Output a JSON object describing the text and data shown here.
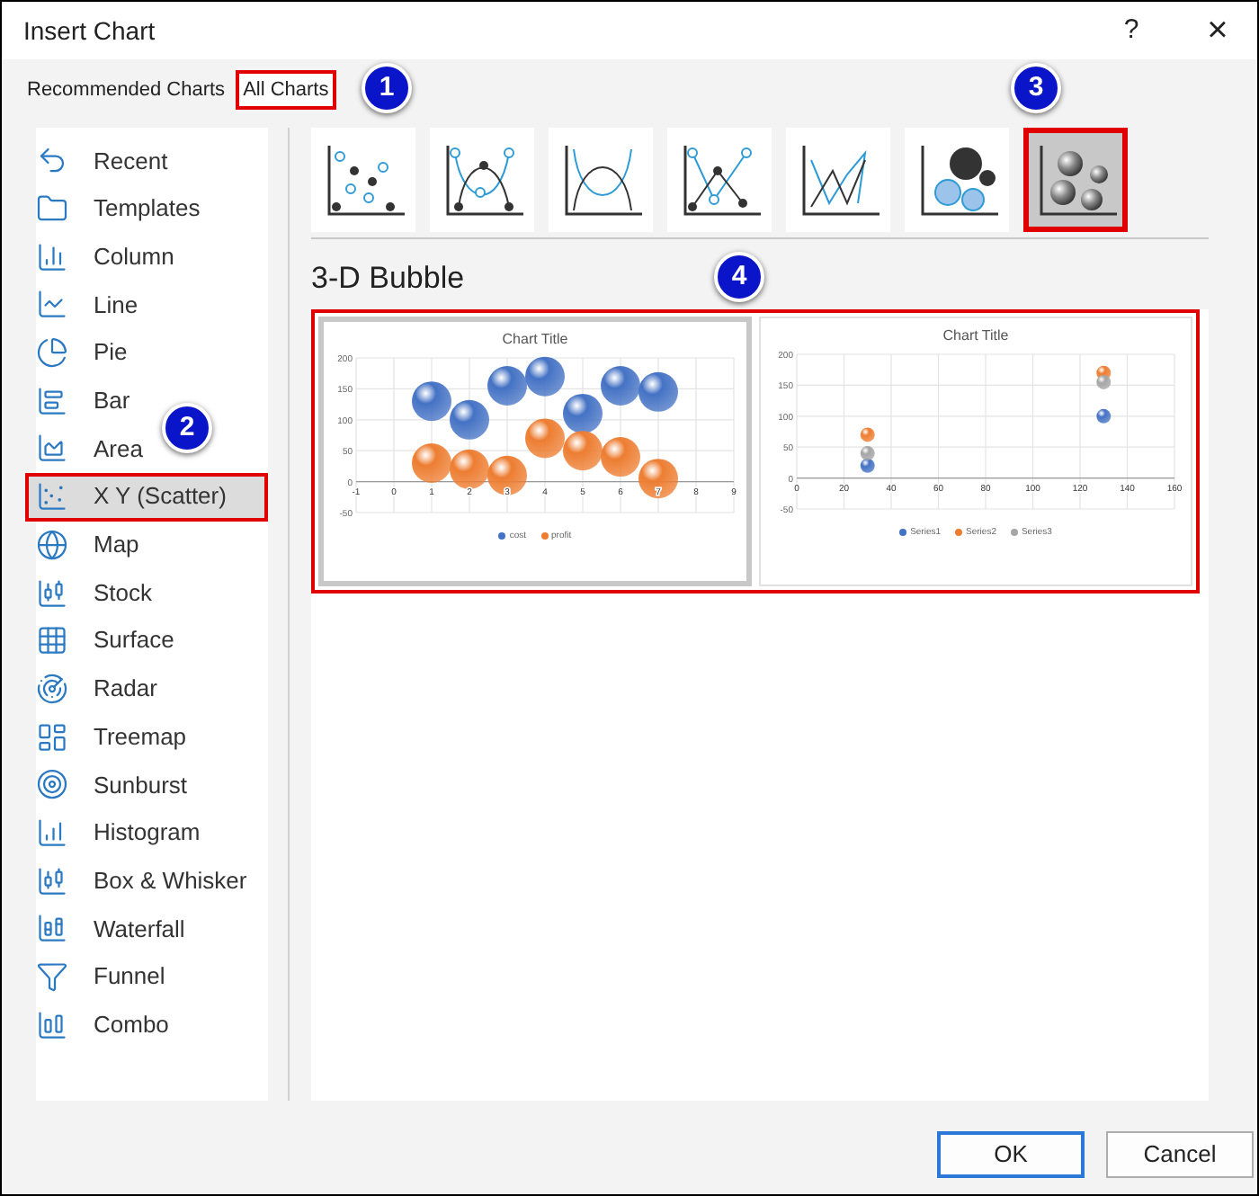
{
  "window": {
    "title": "Insert Chart",
    "help": "?",
    "close": "×"
  },
  "tabs": [
    {
      "label": "Recommended Charts",
      "selected": false,
      "highlighted": false
    },
    {
      "label": "All Charts",
      "selected": true,
      "highlighted": true
    }
  ],
  "sidebar": {
    "items": [
      {
        "label": "Recent",
        "selected": false,
        "highlighted": false
      },
      {
        "label": "Templates",
        "selected": false,
        "highlighted": false
      },
      {
        "label": "Column",
        "selected": false,
        "highlighted": false
      },
      {
        "label": "Line",
        "selected": false,
        "highlighted": false
      },
      {
        "label": "Pie",
        "selected": false,
        "highlighted": false
      },
      {
        "label": "Bar",
        "selected": false,
        "highlighted": false
      },
      {
        "label": "Area",
        "selected": false,
        "highlighted": false
      },
      {
        "label": "X Y (Scatter)",
        "selected": true,
        "highlighted": true
      },
      {
        "label": "Map",
        "selected": false,
        "highlighted": false
      },
      {
        "label": "Stock",
        "selected": false,
        "highlighted": false
      },
      {
        "label": "Surface",
        "selected": false,
        "highlighted": false
      },
      {
        "label": "Radar",
        "selected": false,
        "highlighted": false
      },
      {
        "label": "Treemap",
        "selected": false,
        "highlighted": false
      },
      {
        "label": "Sunburst",
        "selected": false,
        "highlighted": false
      },
      {
        "label": "Histogram",
        "selected": false,
        "highlighted": false
      },
      {
        "label": "Box & Whisker",
        "selected": false,
        "highlighted": false
      },
      {
        "label": "Waterfall",
        "selected": false,
        "highlighted": false
      },
      {
        "label": "Funnel",
        "selected": false,
        "highlighted": false
      },
      {
        "label": "Combo",
        "selected": false,
        "highlighted": false
      }
    ]
  },
  "subtypes": [
    {
      "selected": false,
      "highlighted": false
    },
    {
      "selected": false,
      "highlighted": false
    },
    {
      "selected": false,
      "highlighted": false
    },
    {
      "selected": false,
      "highlighted": false
    },
    {
      "selected": false,
      "highlighted": false
    },
    {
      "selected": false,
      "highlighted": false
    },
    {
      "selected": true,
      "highlighted": true
    }
  ],
  "gallery": {
    "title": "3-D Bubble",
    "highlighted": true,
    "previews": [
      {
        "selected": true,
        "chart_data": {
          "type": "scatter",
          "grid": true,
          "title": "Chart Title",
          "xlim": [
            -1,
            9
          ],
          "ylim": [
            -50,
            200
          ],
          "xticks": [
            -1,
            0,
            1,
            2,
            3,
            4,
            5,
            6,
            7,
            8,
            9
          ],
          "yticks": [
            -50,
            0,
            50,
            100,
            150,
            200
          ],
          "series": [
            {
              "name": "cost",
              "color": "#4472c4",
              "x": [
                1,
                2,
                3,
                4,
                5,
                6,
                7
              ],
              "values": [
                130,
                100,
                155,
                170,
                110,
                155,
                145
              ]
            },
            {
              "name": "profit",
              "color": "#ed7d31",
              "x": [
                1,
                2,
                3,
                4,
                5,
                6,
                7
              ],
              "values": [
                30,
                20,
                10,
                70,
                50,
                40,
                5
              ]
            }
          ]
        }
      },
      {
        "selected": false,
        "chart_data": {
          "type": "scatter",
          "grid": true,
          "title": "Chart Title",
          "xlim": [
            0,
            160
          ],
          "ylim": [
            -50,
            200
          ],
          "xticks": [
            0,
            20,
            40,
            60,
            80,
            100,
            120,
            140,
            160
          ],
          "yticks": [
            -50,
            0,
            50,
            100,
            150,
            200
          ],
          "series": [
            {
              "name": "Series1",
              "color": "#4472c4",
              "x": [
                30,
                130
              ],
              "values": [
                20,
                100
              ]
            },
            {
              "name": "Series2",
              "color": "#ed7d31",
              "x": [
                30,
                130
              ],
              "values": [
                70,
                170
              ]
            },
            {
              "name": "Series3",
              "color": "#a5a5a5",
              "x": [
                30,
                130
              ],
              "values": [
                40,
                155
              ]
            }
          ]
        }
      }
    ]
  },
  "callouts": [
    {
      "text": "1"
    },
    {
      "text": "2"
    },
    {
      "text": "3"
    },
    {
      "text": "4"
    }
  ],
  "buttons": [
    {
      "label": "OK",
      "kind": "primary"
    },
    {
      "label": "Cancel",
      "kind": "secondary"
    }
  ]
}
